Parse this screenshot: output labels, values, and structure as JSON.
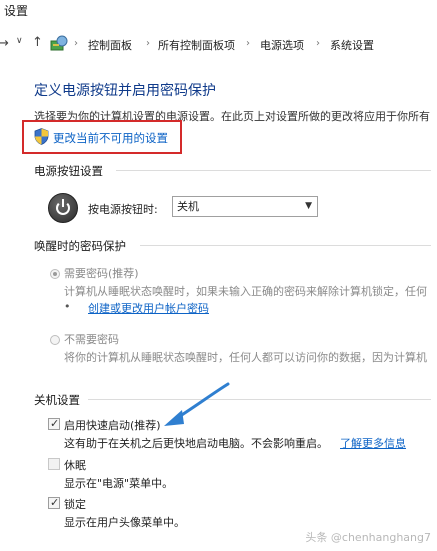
{
  "window": {
    "title": "设置"
  },
  "nav": {
    "back": "←",
    "forward": "→",
    "down": "∨",
    "up": "↑",
    "breadcrumbs": [
      "控制面板",
      "所有控制面板项",
      "电源选项",
      "系统设置"
    ],
    "separator": "›"
  },
  "page": {
    "heading": "定义电源按钮并启用密码保护",
    "description": "选择要为你的计算机设置的电源设置。在此页上对设置所做的更改将应用于你所有",
    "change_settings_link": "更改当前不可用的设置"
  },
  "power_button": {
    "section_title": "电源按钮设置",
    "label": "按电源按钮时:",
    "selected": "关机"
  },
  "wake_password": {
    "section_title": "唤醒时的密码保护",
    "require": {
      "label": "需要密码(推荐)",
      "desc": "计算机从睡眠状态唤醒时，如果未输入正确的密码来解除计算机锁定，任何",
      "link": "创建或更改用户帐户密码"
    },
    "no_require": {
      "label": "不需要密码",
      "desc": "将你的计算机从睡眠状态唤醒时，任何人都可以访问你的数据，因为计算机"
    }
  },
  "shutdown": {
    "section_title": "关机设置",
    "fast_startup": {
      "label": "启用快速启动(推荐)",
      "desc": "这有助于在关机之后更快地启动电脑。不会影响重启。",
      "link": "了解更多信息",
      "checked": true
    },
    "hibernate": {
      "label": "休眠",
      "desc": "显示在\"电源\"菜单中。",
      "checked": false
    },
    "lock": {
      "label": "锁定",
      "desc": "显示在用户头像菜单中。",
      "checked": true
    }
  },
  "watermark": "头条 @chenhanghang7",
  "colors": {
    "heading": "#0f3a8a",
    "link": "#0d63c6",
    "highlight_box": "#d42a2a",
    "arrow": "#2f7fd0"
  }
}
